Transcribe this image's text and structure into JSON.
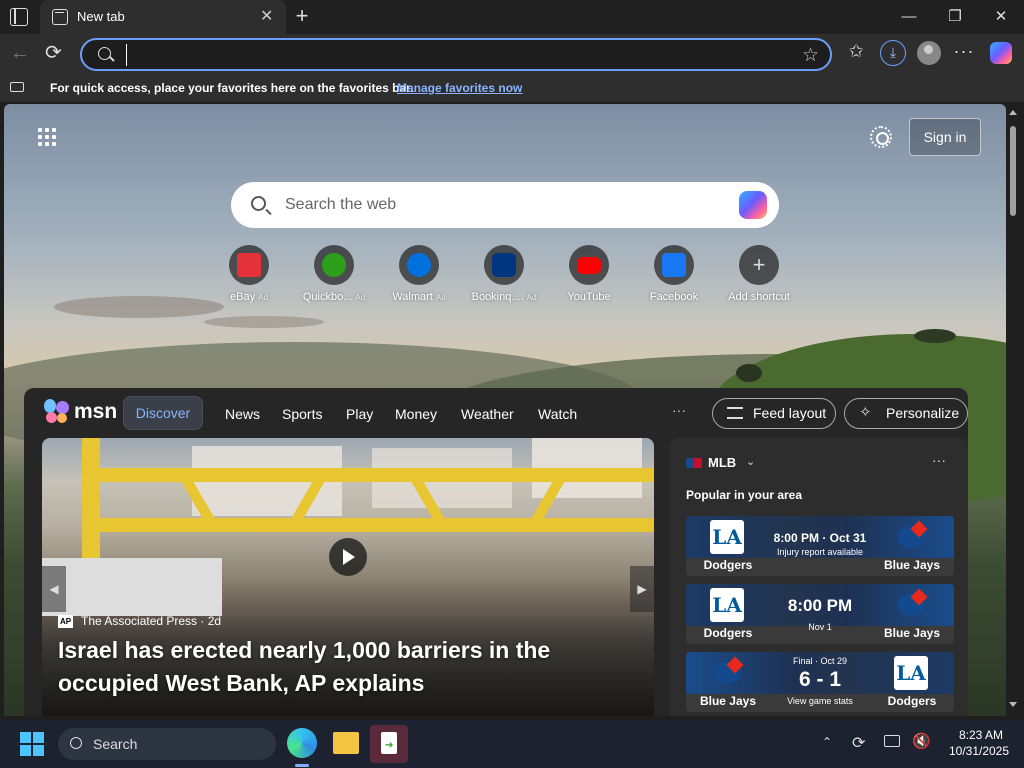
{
  "browser": {
    "tab_title": "New tab",
    "tab_close": "✕",
    "new_tab": "+",
    "window": {
      "minimize": "—",
      "maximize": "❐",
      "close": "✕"
    },
    "address_value": "",
    "favorites_hint": "For quick access, place your favorites here on the favorites bar.",
    "favorites_link": "Manage favorites now"
  },
  "newtab": {
    "signin": "Sign in",
    "search_placeholder": "Search the web",
    "shortcuts": [
      {
        "label": "eBay",
        "ad": "Ad",
        "color": "#e53238"
      },
      {
        "label": "Quickbo...",
        "ad": "Ad",
        "color": "#2ca01c"
      },
      {
        "label": "Walmart",
        "ad": "Ad",
        "color": "#0071dc"
      },
      {
        "label": "Bookinq....",
        "ad": "Ad",
        "color": "#003580"
      },
      {
        "label": "YouTube",
        "ad": "",
        "color": "#ff0000"
      },
      {
        "label": "Facebook",
        "ad": "",
        "color": "#1877f2"
      },
      {
        "label": "Add shortcut",
        "ad": "",
        "color": "#777777"
      }
    ]
  },
  "msn": {
    "brand": "msn",
    "nav": [
      "Discover",
      "News",
      "Sports",
      "Play",
      "Money",
      "Weather",
      "Watch"
    ],
    "more": "···",
    "feed_layout": "Feed layout",
    "personalize": "Personalize",
    "hero": {
      "badge": "AP",
      "source": "The Associated Press · 2d",
      "headline": "Israel has erected nearly 1,000 barriers in the occupied West Bank, AP explains",
      "prev": "◀",
      "next": "▶"
    },
    "sports": {
      "title": "MLB",
      "subtitle": "Popular in your area",
      "more": "···",
      "games": [
        {
          "left": "Dodgers",
          "right": "Blue Jays",
          "line1": "8:00 PM · Oct 31",
          "line2": "Injury report available"
        },
        {
          "left": "Dodgers",
          "right": "Blue Jays",
          "line1": "8:00 PM",
          "line2": "Nov 1"
        },
        {
          "left": "Blue Jays",
          "right": "Dodgers",
          "line0": "Final · Oct 29",
          "score": "6 - 1",
          "line2": "View game stats"
        }
      ]
    }
  },
  "colors": {
    "accent": "#6b9eff",
    "link": "#8ab4ff",
    "taskbar": "#1c2230"
  }
}
